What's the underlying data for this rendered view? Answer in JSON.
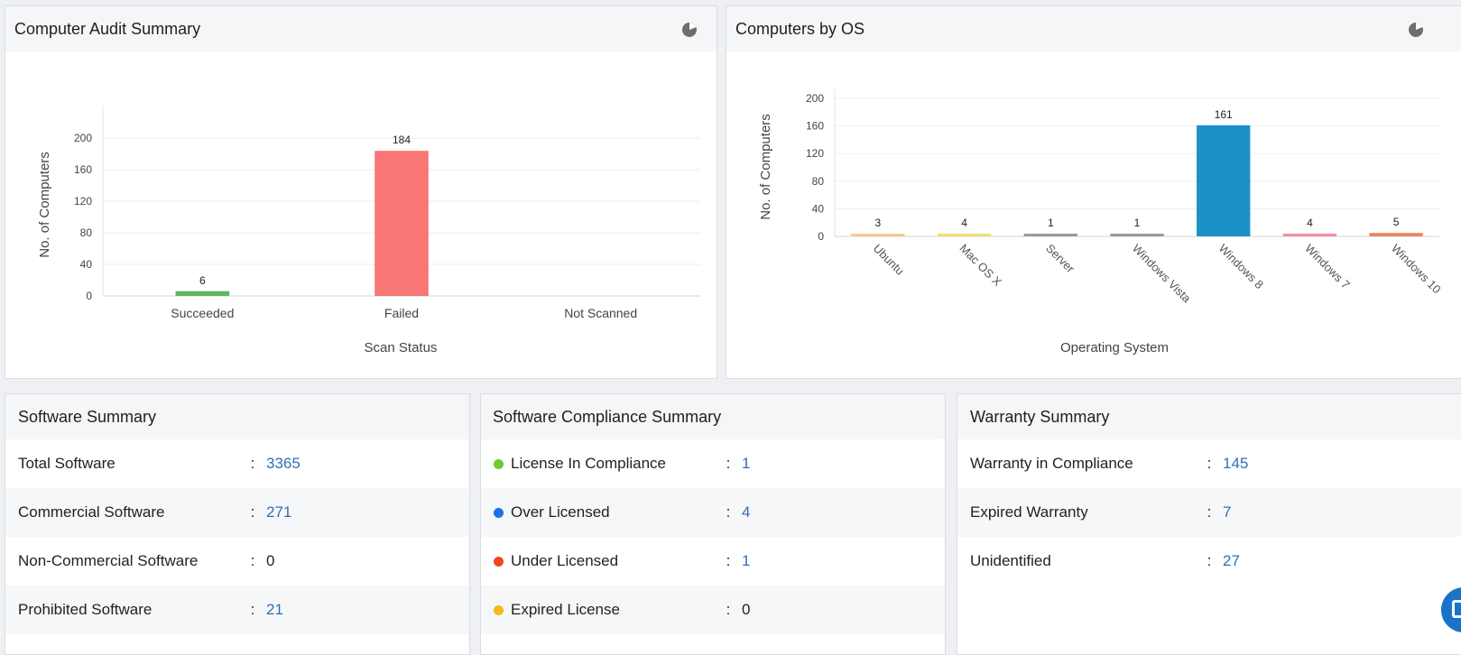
{
  "audit": {
    "title": "Computer Audit Summary",
    "icon": "pie-chart-icon"
  },
  "os": {
    "title": "Computers by OS",
    "icon": "pie-chart-icon"
  },
  "chart_data": [
    {
      "type": "bar",
      "title": "Computer Audit Summary",
      "categories": [
        "Succeeded",
        "Failed",
        "Not Scanned"
      ],
      "values": [
        6,
        184,
        0
      ],
      "data_labels": [
        "6",
        "184",
        ""
      ],
      "colors": [
        "#5cb85c",
        "#f87674",
        "#cccccc"
      ],
      "xlabel": "Scan Status",
      "ylabel": "No. of Computers",
      "yticks": [
        0,
        40,
        80,
        120,
        160,
        200
      ],
      "ytick_labels": [
        "0",
        "40",
        "80",
        "120",
        "160",
        "200"
      ],
      "ylim": [
        0,
        230
      ],
      "grid": true
    },
    {
      "type": "bar",
      "title": "Computers by OS",
      "categories": [
        "Ubuntu",
        "Mac OS X",
        "Server",
        "Windows Vista",
        "Windows 8",
        "Windows 7",
        "Windows 10"
      ],
      "values": [
        3,
        4,
        1,
        1,
        161,
        4,
        5
      ],
      "data_labels": [
        "3",
        "4",
        "1",
        "1",
        "161",
        "4",
        "5"
      ],
      "colors": [
        "#f5c98d",
        "#f0e07a",
        "#9a9a9a",
        "#9a9a9a",
        "#1c91c8",
        "#f48fa0",
        "#ef8460"
      ],
      "xlabel": "Operating System",
      "ylabel": "No. of Computers",
      "yticks": [
        0,
        40,
        80,
        120,
        160,
        200
      ],
      "ytick_labels": [
        "0",
        "40",
        "80",
        "120",
        "160",
        "200"
      ],
      "ylim": [
        0,
        200
      ],
      "grid": true
    }
  ],
  "software": {
    "title": "Software Summary",
    "rows": [
      {
        "label": "Total Software",
        "colon": ":",
        "value": "3365"
      },
      {
        "label": "Commercial Software",
        "colon": ":",
        "value": "271"
      },
      {
        "label": "Non-Commercial Software",
        "colon": ":",
        "value": "0"
      },
      {
        "label": "Prohibited Software",
        "colon": ":",
        "value": "21"
      }
    ]
  },
  "compliance": {
    "title": "Software Compliance Summary",
    "rows": [
      {
        "label": "License In Compliance",
        "colon": ":",
        "value": "1",
        "color": "#6ccb2e"
      },
      {
        "label": "Over Licensed",
        "colon": ":",
        "value": "4",
        "color": "#1a73e8"
      },
      {
        "label": "Under Licensed",
        "colon": ":",
        "value": "1",
        "color": "#f0491c"
      },
      {
        "label": "Expired License",
        "colon": ":",
        "value": "0",
        "color": "#f6b918"
      }
    ]
  },
  "warranty": {
    "title": "Warranty Summary",
    "rows": [
      {
        "label": "Warranty in Compliance",
        "colon": ":",
        "value": "145"
      },
      {
        "label": "Expired Warranty",
        "colon": ":",
        "value": "7"
      },
      {
        "label": "Unidentified",
        "colon": ":",
        "value": "27"
      }
    ]
  }
}
